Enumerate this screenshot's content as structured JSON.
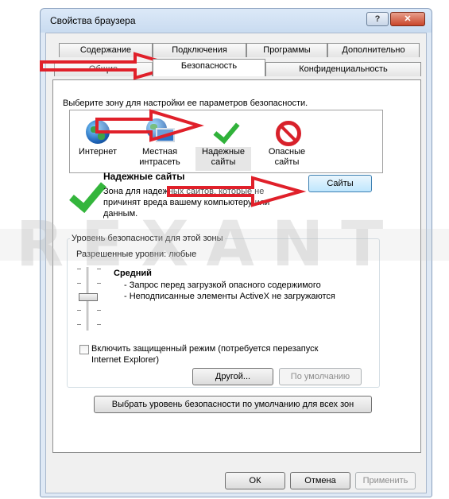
{
  "window": {
    "title": "Свойства браузера"
  },
  "tabs": {
    "row_back": [
      "Содержание",
      "Подключения",
      "Программы",
      "Дополнительно"
    ],
    "row_front": [
      "Общие",
      "Безопасность",
      "Конфиденциальность"
    ],
    "active": "Безопасность"
  },
  "security": {
    "zone_prompt": "Выберите зону для настройки ее параметров безопасности.",
    "zones": [
      {
        "label_1": "Интернет",
        "label_2": "",
        "icon": "globe-icon"
      },
      {
        "label_1": "Местная",
        "label_2": "интрасеть",
        "icon": "intranet-icon"
      },
      {
        "label_1": "Надежные",
        "label_2": "сайты",
        "icon": "check-icon"
      },
      {
        "label_1": "Опасные",
        "label_2": "сайты",
        "icon": "no-entry-icon"
      }
    ],
    "selected_zone": {
      "title": "Надежные сайты",
      "desc_1": "Зона для надежных сайтов, которые не",
      "desc_2": "причинят вреда вашему компьютеру или",
      "desc_3": "данным."
    },
    "sites_button": "Сайты",
    "level_group": {
      "title": "Уровень безопасности для этой зоны",
      "allowed": "Разрешенные уровни: любые",
      "level_name": "Средний",
      "level_line_1": "- Запрос перед загрузкой опасного содержимого",
      "level_line_2": "- Неподписанные элементы ActiveX не загружаются",
      "protected_mode_1": "Включить защищенный режим (потребуется перезапуск",
      "protected_mode_2": "Internet Explorer)",
      "custom_button": "Другой...",
      "default_button": "По умолчанию"
    },
    "reset_all_button": "Выбрать уровень безопасности по умолчанию для всех зон"
  },
  "footer": {
    "ok": "ОК",
    "cancel": "Отмена",
    "apply": "Применить"
  },
  "watermark": "REXANT",
  "colors": {
    "arrow": "#e0202a",
    "check": "#30b23a",
    "danger": "#d8212b"
  }
}
